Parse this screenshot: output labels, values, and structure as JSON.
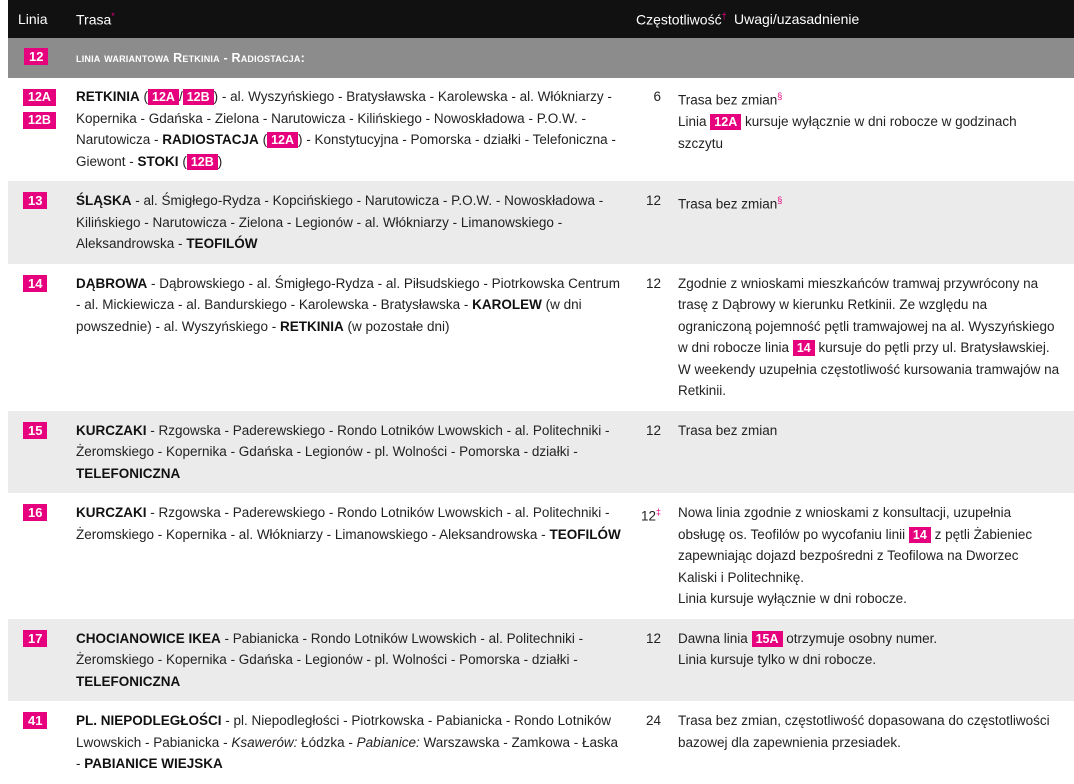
{
  "header": {
    "col_line": "Linia",
    "col_route": "Trasa",
    "col_route_mark": "*",
    "col_freq": "Częstotliwość",
    "col_freq_mark": "†",
    "col_notes": "Uwagi/uzasadnienie"
  },
  "banner": {
    "line": "12",
    "title": "linia wariantowa Retkinia - Radiostacja:"
  },
  "rows": [
    {
      "lines": [
        "12A",
        "12B"
      ],
      "route_a": "RETKINIA",
      "route_b": "al. Wyszyńskiego - Bratysławska - Karolewska - al. Włókniarzy - Kopernika - Gdańska - Zielona - Narutowicza - Kilińskiego - Nowoskładowa - P.O.W. - Narutowicza -",
      "route_c": "RADIOSTACJA",
      "route_d": "- Konstytucyjna - Pomorska - działki - Telefoniczna - Giewont -",
      "route_e": "STOKI",
      "freq": "6",
      "note1": "Trasa bez zmian",
      "note_mark": "§",
      "note2_a": "Linia",
      "note2_badge": "12A",
      "note2_b": "kursuje wyłącznie w dni robocze w godzinach szczytu"
    },
    {
      "line": "13",
      "route_a": "ŚLĄSKA",
      "route_b": "- al. Śmigłego-Rydza - Kopcińskiego - Narutowicza - P.O.W. - Nowoskładowa - Kilińskiego - Narutowicza - Zielona - Legionów - al. Włókniarzy - Limanowskiego - Aleksandrowska -",
      "route_c": "TEOFILÓW",
      "freq": "12",
      "note": "Trasa bez zmian",
      "note_mark": "§"
    },
    {
      "line": "14",
      "route_a": "DĄBROWA",
      "route_b": "- Dąbrowskiego - al. Śmigłego-Rydza - al. Piłsudskiego - Piotrkowska Centrum - al. Mickiewicza - al. Bandurskiego - Karolewska - Bratysławska -",
      "route_c": "KAROLEW",
      "route_d": "(w dni powszednie) - al. Wyszyńskiego -",
      "route_e": "RETKINIA",
      "route_f": "(w pozostałe dni)",
      "freq": "12",
      "note_a": "Zgodnie z wnioskami mieszkańców tramwaj przywrócony na trasę z Dąbrowy w kierunku Retkinii. Ze względu na ograniczoną pojemność pętli tramwajowej na al. Wyszyńskiego w dni robocze linia",
      "note_badge": "14",
      "note_b": "kursuje do pętli przy ul. Bratysławskiej. W weekendy uzupełnia częstotliwość kursowania tramwajów na Retkinii."
    },
    {
      "line": "15",
      "route_a": "KURCZAKI",
      "route_b": "- Rzgowska - Paderewskiego - Rondo Lotników Lwowskich - al. Politechniki - Żeromskiego - Kopernika - Gdańska - Legionów - pl. Wolności - Pomorska - działki -",
      "route_c": "TELEFONICZNA",
      "freq": "12",
      "note": "Trasa bez zmian"
    },
    {
      "line": "16",
      "route_a": "KURCZAKI",
      "route_b": "- Rzgowska - Paderewskiego - Rondo Lotników Lwowskich - al. Politechniki - Żeromskiego - Kopernika - al. Włókniarzy - Limanowskiego - Aleksandrowska -",
      "route_c": "TEOFILÓW",
      "freq": "12",
      "freq_mark": "‡",
      "note_a": "Nowa linia zgodnie z wnioskami z konsultacji, uzupełnia obsługę os. Teofilów po wycofaniu linii",
      "note_badge": "14",
      "note_b": "z pętli Żabieniec zapewniając dojazd bezpośredni z Teofilowa na Dworzec Kaliski i Politechnikę.",
      "note_c": "Linia kursuje wyłącznie w dni robocze."
    },
    {
      "line": "17",
      "route_a": "CHOCIANOWICE IKEA",
      "route_b": "- Pabianicka - Rondo Lotników Lwowskich - al. Politechniki - Żeromskiego - Kopernika - Gdańska - Legionów - pl. Wolności - Pomorska - działki -",
      "route_c": "TELEFONICZNA",
      "freq": "12",
      "note_a": "Dawna linia",
      "note_badge": "15A",
      "note_b": "otrzymuje osobny numer.",
      "note_c": "Linia kursuje tylko w dni robocze."
    },
    {
      "line": "41",
      "route_a": "PL. NIEPODLEGŁOŚCI",
      "route_b": "- pl. Niepodległości - Piotrkowska - Pabianicka - Rondo Lotników Lwowskich - Pabianicka -",
      "route_i1": "Ksawerów:",
      "route_c": "Łódzka -",
      "route_i2": "Pabianice:",
      "route_d": "Warszawska - Zamkowa - Łaska -",
      "route_e": "PABIANICE WIEJSKA",
      "freq": "24",
      "note": "Trasa bez zmian, częstotliwość dopasowana do częstotliwości bazowej dla zapewnienia przesiadek."
    }
  ]
}
